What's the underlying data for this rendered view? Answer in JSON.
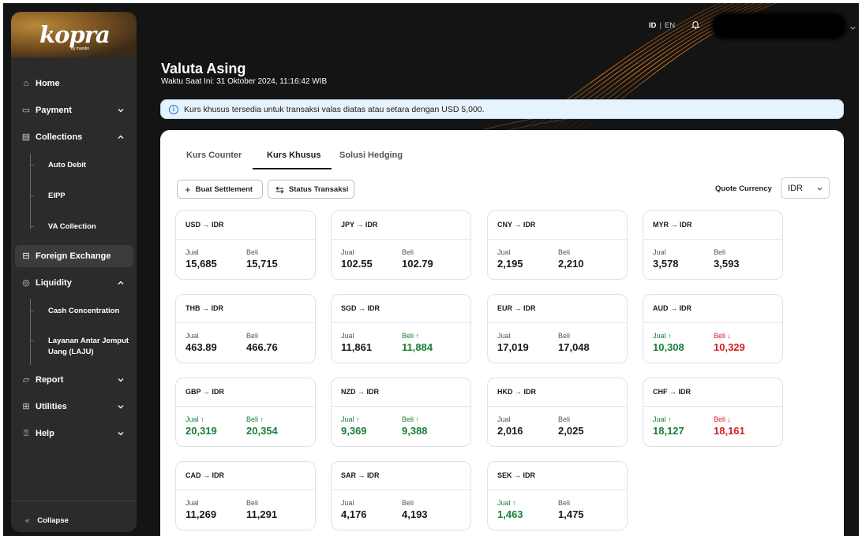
{
  "sidebar": {
    "logo": "kopra",
    "logo_sub": "by mandiri",
    "items": [
      {
        "label": "Home",
        "icon": "home-icon"
      },
      {
        "label": "Payment",
        "icon": "payment-icon"
      },
      {
        "label": "Collections",
        "icon": "collections-icon"
      },
      {
        "label": "Foreign Exchange",
        "icon": "foreign-exchange-icon"
      },
      {
        "label": "Liquidity",
        "icon": "liquidity-icon"
      },
      {
        "label": "Report",
        "icon": "report-icon"
      },
      {
        "label": "Utilities",
        "icon": "utilities-icon"
      },
      {
        "label": "Help",
        "icon": "help-icon"
      }
    ],
    "collections_sub": [
      "Auto Debit",
      "EIPP",
      "VA Collection"
    ],
    "liquidity_sub": [
      "Cash Concentration",
      "Layanan Antar Jemput",
      "Uang (LAJU)"
    ],
    "collapse": "Collapse"
  },
  "header": {
    "lang_id": "ID",
    "lang_sep": "|",
    "lang_en": "EN",
    "title": "Valuta Asing",
    "time": "Waktu Saat Ini:  31 Oktober 2024, 11:16:42 WIB"
  },
  "banner": {
    "text": "Kurs khusus tersedia untuk transaksi valas diatas atau setara dengan USD 5,000."
  },
  "tabs": [
    "Kurs Counter",
    "Kurs Khusus",
    "Solusi Hedging"
  ],
  "active_tab": "Kurs Khusus",
  "actions": {
    "settlement": "Buat Settlement",
    "status": "Status Transaksi"
  },
  "quote": {
    "label": "Quote Currency",
    "value": "IDR"
  },
  "labels": {
    "sell": "Jual",
    "buy": "Beli",
    "arrow": "→"
  },
  "rates": [
    {
      "from": "USD",
      "to": "IDR",
      "jual": "15,685",
      "beli": "15,715",
      "jual_trend": "",
      "beli_trend": ""
    },
    {
      "from": "JPY",
      "to": "IDR",
      "jual": "102.55",
      "beli": "102.79",
      "jual_trend": "",
      "beli_trend": ""
    },
    {
      "from": "CNY",
      "to": "IDR",
      "jual": "2,195",
      "beli": "2,210",
      "jual_trend": "",
      "beli_trend": ""
    },
    {
      "from": "MYR",
      "to": "IDR",
      "jual": "3,578",
      "beli": "3,593",
      "jual_trend": "",
      "beli_trend": ""
    },
    {
      "from": "THB",
      "to": "IDR",
      "jual": "463.89",
      "beli": "466.76",
      "jual_trend": "",
      "beli_trend": ""
    },
    {
      "from": "SGD",
      "to": "IDR",
      "jual": "11,861",
      "beli": "11,884",
      "jual_trend": "",
      "beli_trend": "up"
    },
    {
      "from": "EUR",
      "to": "IDR",
      "jual": "17,019",
      "beli": "17,048",
      "jual_trend": "",
      "beli_trend": ""
    },
    {
      "from": "AUD",
      "to": "IDR",
      "jual": "10,308",
      "beli": "10,329",
      "jual_trend": "up",
      "beli_trend": "down"
    },
    {
      "from": "GBP",
      "to": "IDR",
      "jual": "20,319",
      "beli": "20,354",
      "jual_trend": "up",
      "beli_trend": "up"
    },
    {
      "from": "NZD",
      "to": "IDR",
      "jual": "9,369",
      "beli": "9,388",
      "jual_trend": "up",
      "beli_trend": "up"
    },
    {
      "from": "HKD",
      "to": "IDR",
      "jual": "2,016",
      "beli": "2,025",
      "jual_trend": "",
      "beli_trend": ""
    },
    {
      "from": "CHF",
      "to": "IDR",
      "jual": "18,127",
      "beli": "18,161",
      "jual_trend": "up",
      "beli_trend": "down"
    },
    {
      "from": "CAD",
      "to": "IDR",
      "jual": "11,269",
      "beli": "11,291",
      "jual_trend": "",
      "beli_trend": ""
    },
    {
      "from": "SAR",
      "to": "IDR",
      "jual": "4,176",
      "beli": "4,193",
      "jual_trend": "",
      "beli_trend": ""
    },
    {
      "from": "SEK",
      "to": "IDR",
      "jual": "1,463",
      "beli": "1,475",
      "jual_trend": "up",
      "beli_trend": ""
    }
  ],
  "colors": {
    "up": "#1a7f37",
    "down": "#d32020",
    "brand": "#e07a1a",
    "info": "#1f73c9"
  }
}
